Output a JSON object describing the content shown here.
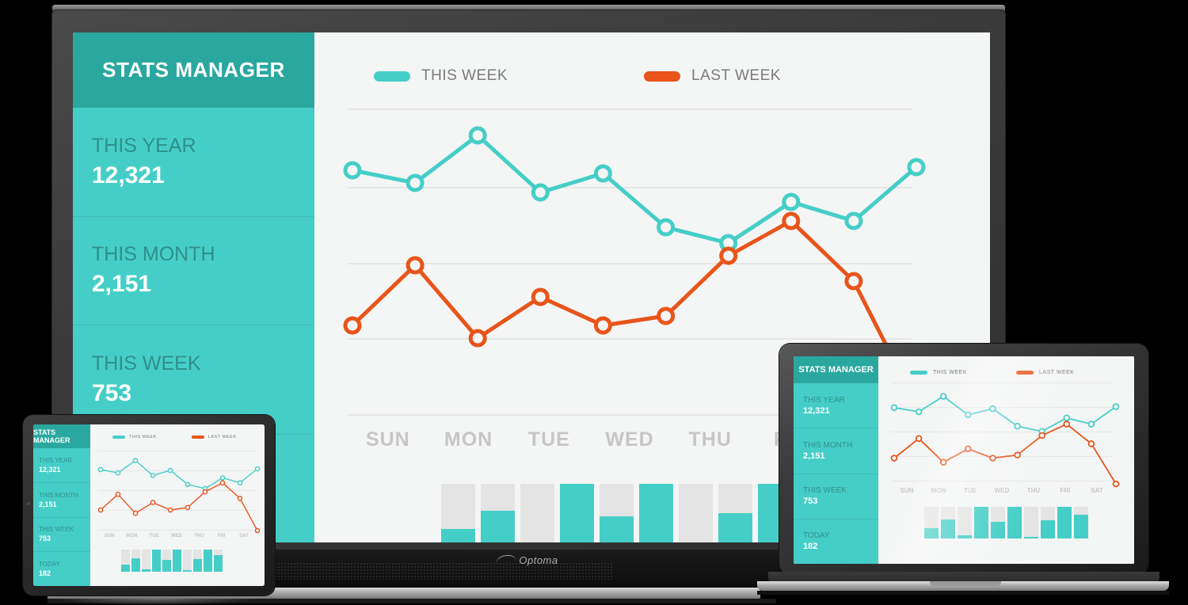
{
  "devices": {
    "tv": {
      "brand": "Optoma"
    },
    "tablet": {
      "name": "tablet"
    },
    "laptop": {
      "name": "laptop"
    }
  },
  "dashboard": {
    "title": "STATS MANAGER",
    "stats": [
      {
        "label": "THIS YEAR",
        "value": "12,321"
      },
      {
        "label": "THIS MONTH",
        "value": "2,151"
      },
      {
        "label": "THIS WEEK",
        "value": "753"
      },
      {
        "label": "TODAY",
        "value": "182"
      }
    ],
    "legend": [
      {
        "label": "THIS WEEK",
        "color": "#45cec7"
      },
      {
        "label": "LAST  WEEK",
        "color": "#e8541a"
      }
    ],
    "colors": {
      "sidebar_header": "#2aa8a0",
      "sidebar_body": "#45cec7",
      "this_week": "#45cec7",
      "last_week": "#e8541a",
      "panel_bg": "#f4f5f5",
      "gridline": "#e6e6e6",
      "bar_track": "#e4e4e4",
      "x_label": "#c6c6c6"
    }
  },
  "chart_data": {
    "type": "line",
    "title": "",
    "xlabel": "",
    "ylabel": "",
    "grid": true,
    "legend_position": "top",
    "categories": [
      "SUN",
      "MON",
      "TUE",
      "WED",
      "THU",
      "FRI",
      "SAT"
    ],
    "x": [
      0,
      1,
      2,
      3,
      4,
      5,
      6,
      7,
      8,
      9
    ],
    "ylim": [
      0,
      100
    ],
    "series": [
      {
        "name": "THIS WEEK",
        "color": "#45cec7",
        "values": [
          74,
          70,
          85,
          67,
          73,
          56,
          51,
          64,
          58,
          75
        ]
      },
      {
        "name": "LAST  WEEK",
        "color": "#e8541a",
        "values": [
          25,
          44,
          21,
          34,
          25,
          28,
          47,
          58,
          39,
          0
        ]
      }
    ],
    "bars": {
      "type": "bar",
      "track_max": 100,
      "values": [
        33,
        60,
        11,
        100,
        52,
        100,
        6,
        57,
        100,
        74
      ]
    }
  },
  "xlabels_visible_tv": [
    "SUN",
    "MON",
    "TUE",
    "WED",
    "THU"
  ]
}
